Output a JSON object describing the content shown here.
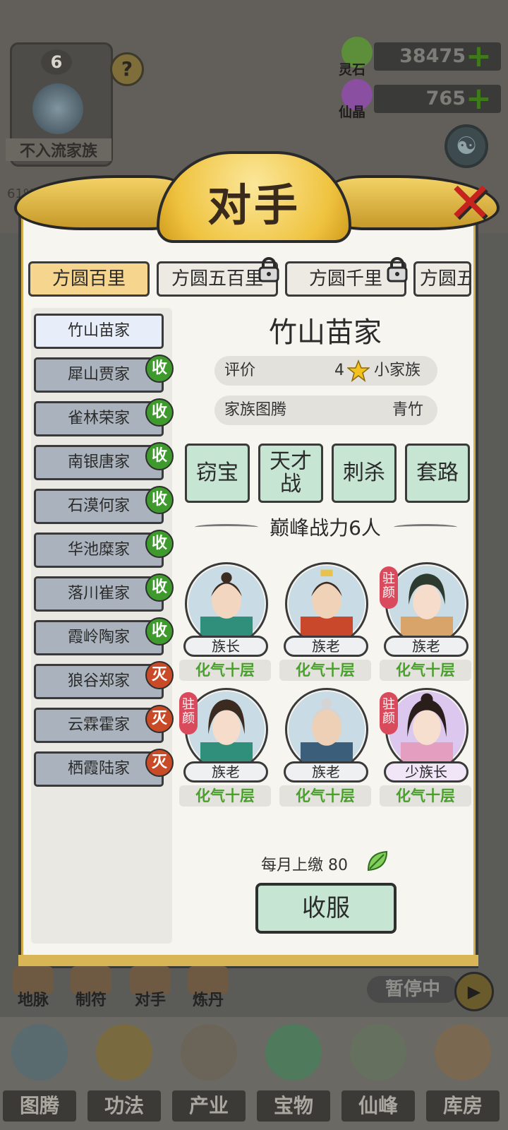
{
  "background": {
    "clan_level": "6",
    "clan_help_icon": "question-icon",
    "clan_title": "不入流家族",
    "clan_progress": "61%",
    "resources": [
      {
        "label": "灵石",
        "value": "38475",
        "icon": "spirit-stone-icon",
        "color": "#5d8f3a"
      },
      {
        "label": "仙晶",
        "value": "765",
        "icon": "immortal-crystal-icon",
        "color": "#8a4fa0"
      }
    ]
  },
  "modal": {
    "title": "对手",
    "tabs": [
      {
        "label": "方圆百里",
        "locked": false,
        "active": true
      },
      {
        "label": "方圆五百里",
        "locked": true,
        "active": false
      },
      {
        "label": "方圆千里",
        "locked": true,
        "active": false
      },
      {
        "label": "方圆五",
        "locked": false,
        "active": false
      }
    ],
    "families": [
      {
        "name": "竹山苗家",
        "badge": ""
      },
      {
        "name": "犀山贾家",
        "badge": "收"
      },
      {
        "name": "雀林荣家",
        "badge": "收"
      },
      {
        "name": "南银唐家",
        "badge": "收"
      },
      {
        "name": "石漠何家",
        "badge": "收"
      },
      {
        "name": "华池糜家",
        "badge": "收"
      },
      {
        "name": "落川崔家",
        "badge": "收"
      },
      {
        "name": "霞岭陶家",
        "badge": "收"
      },
      {
        "name": "狼谷郑家",
        "badge": "灭"
      },
      {
        "name": "云霖霍家",
        "badge": "灭"
      },
      {
        "name": "栖霞陆家",
        "badge": "灭"
      }
    ],
    "detail": {
      "name": "竹山苗家",
      "rating_label": "评价",
      "rating_value": "4",
      "rating_suffix": "小家族",
      "totem_label": "家族图腾",
      "totem_value": "青竹",
      "actions": [
        "窃宝",
        "天才战",
        "刺杀",
        "套路"
      ],
      "power_title": "巅峰战力6人",
      "members": [
        {
          "role": "族长",
          "realm": "化气十层",
          "resident": false,
          "tag": "",
          "ring": "#9fb3be",
          "outfit": "#2f8f7a"
        },
        {
          "role": "族老",
          "realm": "化气十层",
          "resident": false,
          "tag": "",
          "ring": "#9fb3be",
          "outfit": "#c9472b"
        },
        {
          "role": "族老",
          "realm": "化气十层",
          "resident": true,
          "tag": "驻颜",
          "ring": "#9fb3be",
          "outfit": "#d9a46a"
        },
        {
          "role": "族老",
          "realm": "化气十层",
          "resident": true,
          "tag": "驻颜",
          "ring": "#9fb3be",
          "outfit": "#2f8f7a"
        },
        {
          "role": "族老",
          "realm": "化气十层",
          "resident": false,
          "tag": "",
          "ring": "#9fb3be",
          "outfit": "#3b5f7a"
        },
        {
          "role": "少族长",
          "realm": "化气十层",
          "resident": true,
          "tag": "驻颜",
          "ring": "#b48bd6",
          "outfit": "#e49fc0"
        }
      ],
      "tribute_label": "每月上缴",
      "tribute_value": "80",
      "subdue_button": "收服"
    }
  },
  "bottom": {
    "quick_actions": [
      "地脉",
      "制符",
      "对手",
      "炼丹"
    ],
    "status": "暂停中",
    "nav": [
      "图腾",
      "功法",
      "产业",
      "宝物",
      "仙峰",
      "库房"
    ]
  }
}
